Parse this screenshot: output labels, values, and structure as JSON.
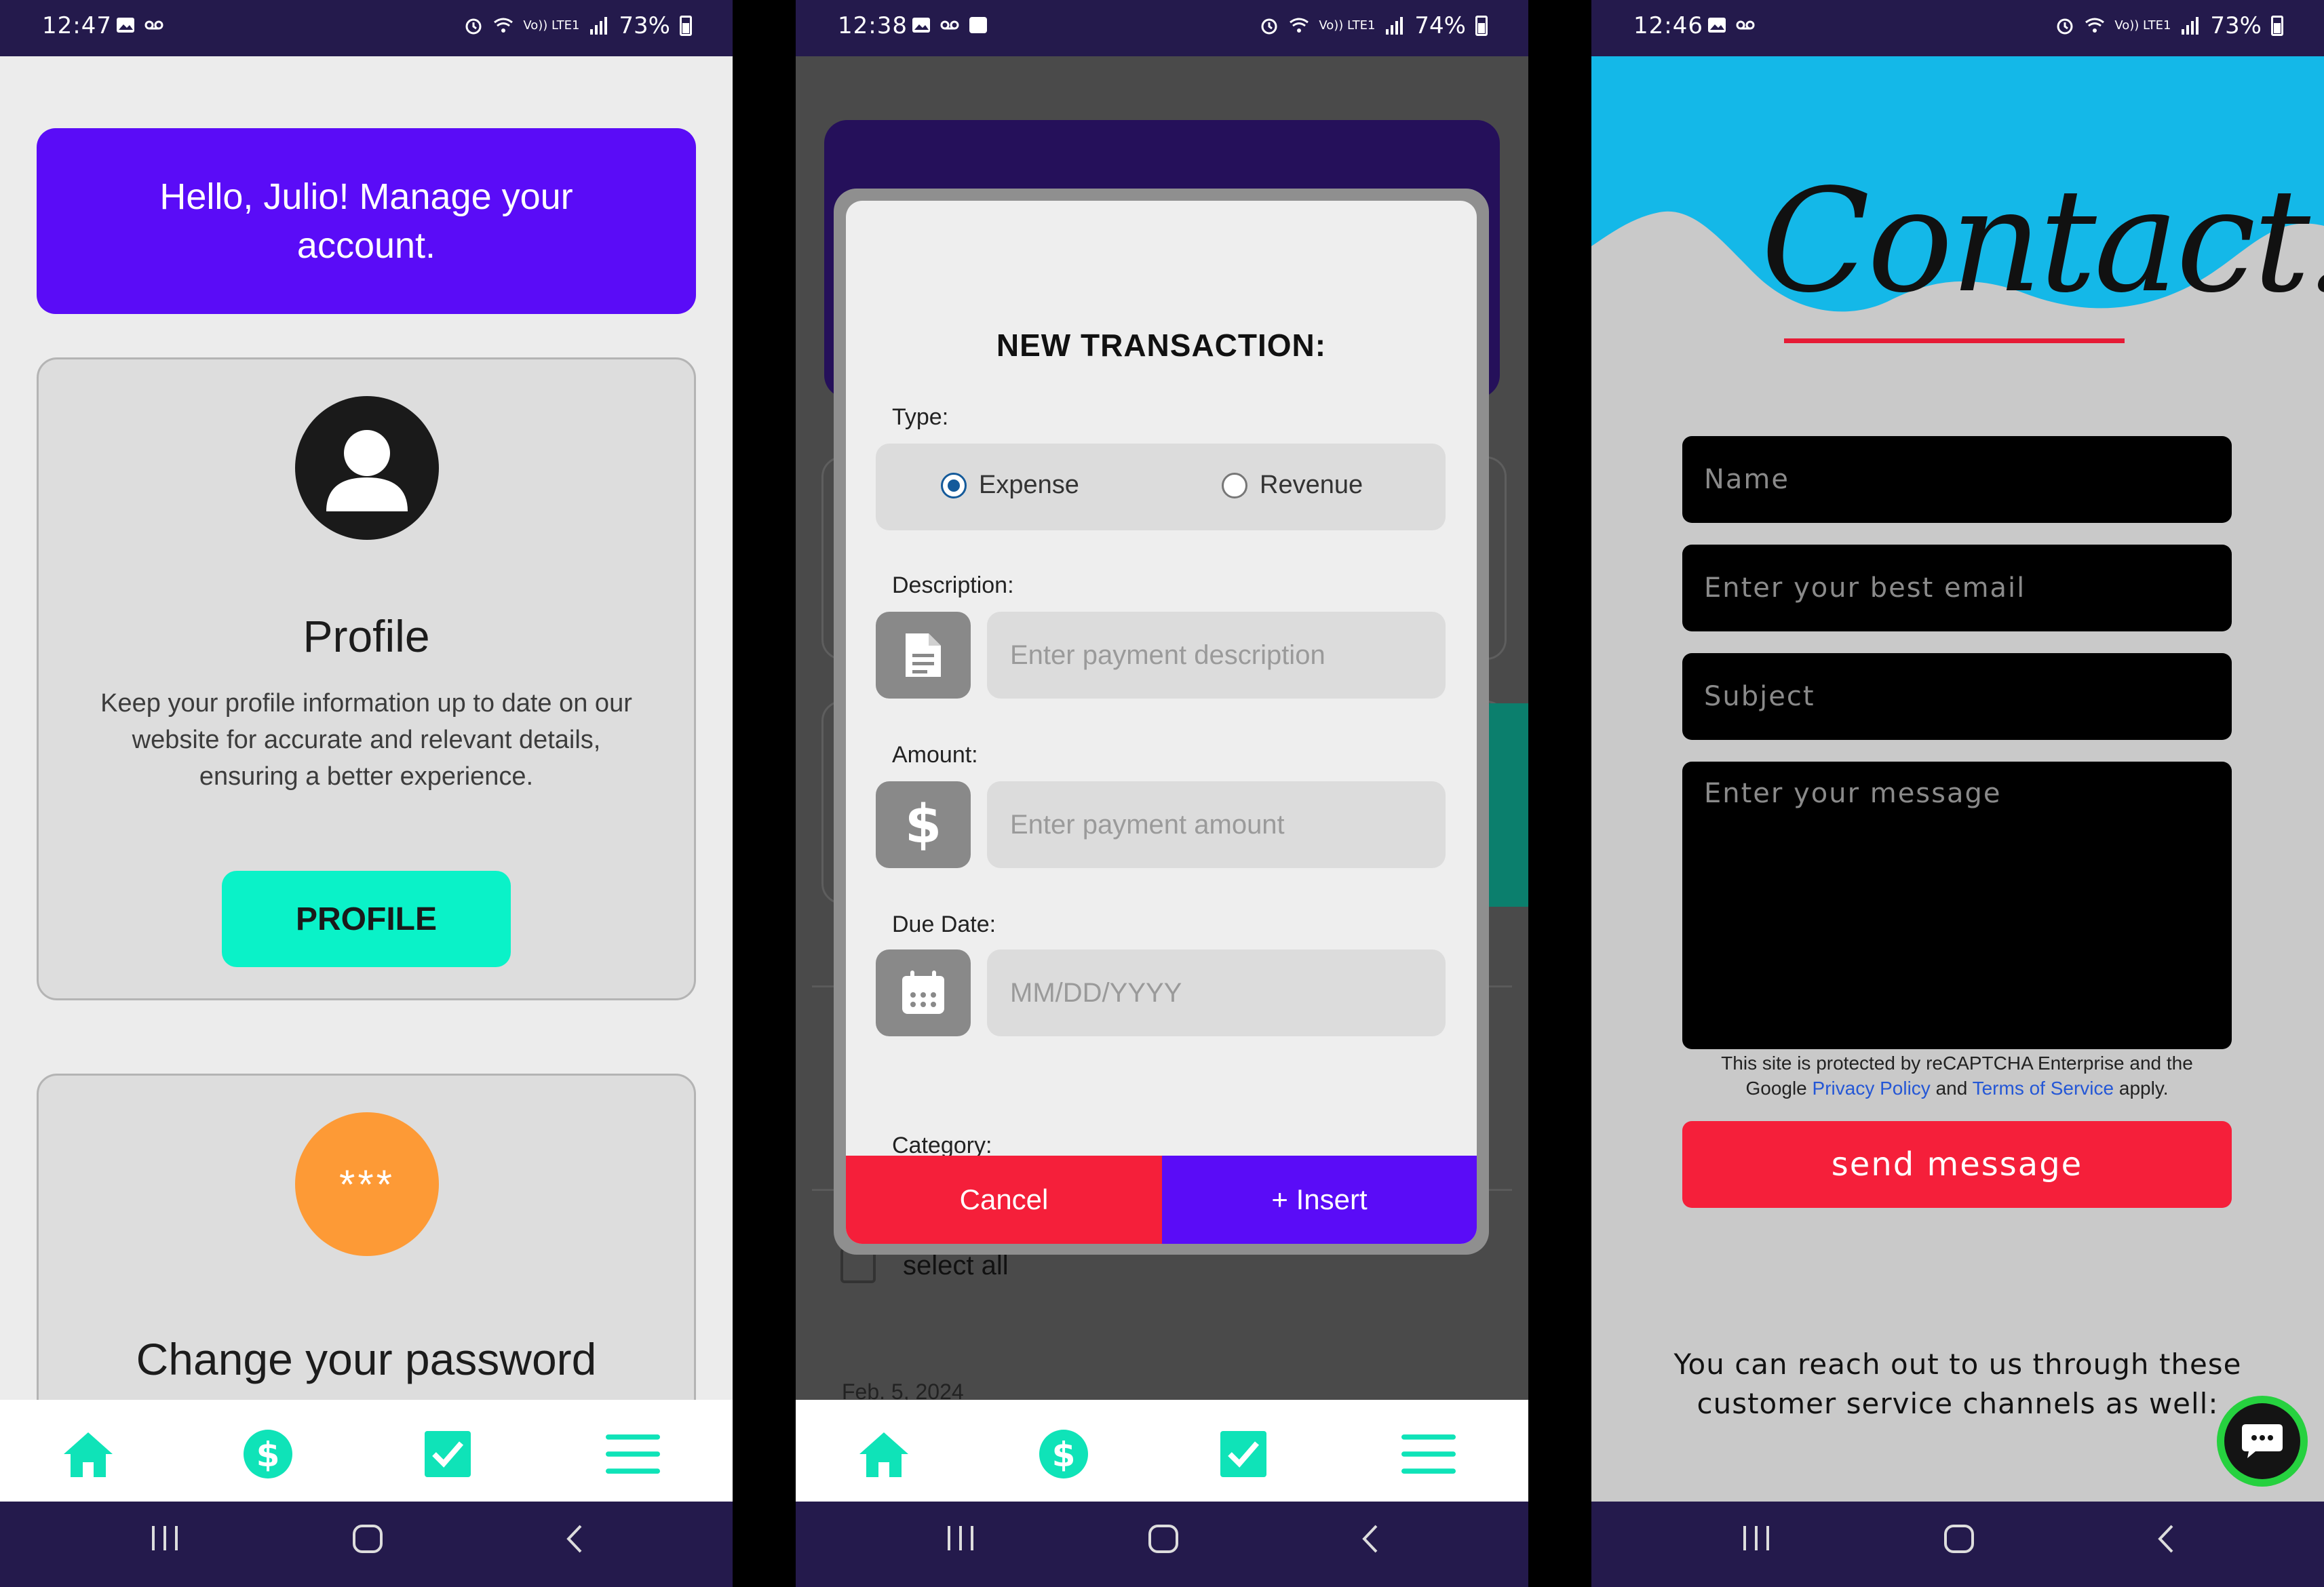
{
  "colors": {
    "status_bar": "#241a4c",
    "accent_purple": "#5a0cf7",
    "accent_teal": "#0af2c8",
    "accent_red": "#f51f3a",
    "orange": "#fd9a36",
    "sky_blue": "#14b8e8"
  },
  "screen1": {
    "status": {
      "time": "12:47",
      "network": "Vo)) LTE1",
      "battery": "73%"
    },
    "banner": "Hello, Julio! Manage your account.",
    "profile_card": {
      "icon": "user-icon",
      "title": "Profile",
      "description": "Keep your profile information up to date on our website for accurate and relevant details, ensuring a better experience.",
      "button": "PROFILE"
    },
    "password_card": {
      "icon_text": "***",
      "title": "Change your password"
    },
    "tabs": [
      "home-icon",
      "dollar-icon",
      "checkbox-icon",
      "menu-icon"
    ]
  },
  "screen2": {
    "status": {
      "time": "12:38",
      "network": "Vo)) LTE1",
      "battery": "74%"
    },
    "modal": {
      "title": "NEW TRANSACTION:",
      "type_label": "Type:",
      "type_options": [
        "Expense",
        "Revenue"
      ],
      "type_selected": "Expense",
      "description_label": "Description:",
      "description_placeholder": "Enter payment description",
      "amount_label": "Amount:",
      "amount_placeholder": "Enter payment amount",
      "due_date_label": "Due Date:",
      "due_date_placeholder": "MM/DD/YYYY",
      "category_label": "Category:",
      "cancel": "Cancel",
      "insert": "+ Insert"
    },
    "background": {
      "select_all": "select all",
      "date": "Feb. 5, 2024"
    }
  },
  "screen3": {
    "status": {
      "time": "12:46",
      "network": "Vo)) LTE1",
      "battery": "73%"
    },
    "title": "Contact:",
    "form": {
      "name_placeholder": "Name",
      "email_placeholder": "Enter your best email",
      "subject_placeholder": "Subject",
      "message_placeholder": "Enter your message"
    },
    "recaptcha": {
      "line1": "This site is protected by reCAPTCHA Enterprise and the",
      "google": "Google",
      "privacy": "Privacy Policy",
      "and": "and",
      "terms": "Terms of Service",
      "apply": "apply."
    },
    "send_button": "send message",
    "reach_text": "You can reach out to us through these customer service channels as well:"
  }
}
